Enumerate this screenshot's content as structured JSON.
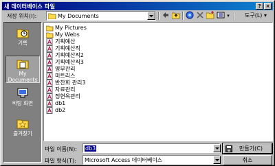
{
  "window": {
    "title": "새 데이터베이스 파일",
    "help_label": "?",
    "close_label": "×"
  },
  "lookin": {
    "label": "저장 위치(I):",
    "value": "My Documents"
  },
  "toolbar": {
    "back_icon": "back-arrow-icon",
    "up_icon": "up-folder-icon",
    "search_web_icon": "search-web-icon",
    "delete_icon": "delete-icon",
    "new_folder_icon": "new-folder-icon",
    "views_icon": "views-icon",
    "tools_label": "도구(L) ▾"
  },
  "places": [
    {
      "label": "기록",
      "icon": "history-icon"
    },
    {
      "label": "My Documents",
      "icon": "my-documents-icon",
      "selected": true
    },
    {
      "label": "바탕 화면",
      "icon": "desktop-icon"
    },
    {
      "label": "즐겨찾기",
      "icon": "favorites-icon"
    }
  ],
  "files": [
    {
      "name": "My Pictures",
      "type": "folder"
    },
    {
      "name": "My Webs",
      "type": "folder"
    },
    {
      "name": "기획예산",
      "type": "db"
    },
    {
      "name": "기획예산직",
      "type": "db"
    },
    {
      "name": "기획예산직2",
      "type": "db"
    },
    {
      "name": "기획예산직3",
      "type": "db"
    },
    {
      "name": "명부관리",
      "type": "db"
    },
    {
      "name": "미트리스",
      "type": "db"
    },
    {
      "name": "반찬회 관리3",
      "type": "db"
    },
    {
      "name": "자료관리",
      "type": "db"
    },
    {
      "name": "정현옥관리",
      "type": "db"
    },
    {
      "name": "db1",
      "type": "db"
    },
    {
      "name": "db2",
      "type": "db"
    }
  ],
  "filename": {
    "label": "파일 이름(N):",
    "value": "db3"
  },
  "filetype": {
    "label": "파일 형식(T):",
    "value": "Microsoft Access 데이터베이스"
  },
  "buttons": {
    "create_label": "만들기(C)",
    "cancel_label": "취소"
  },
  "colors": {
    "titlebar": "#000080",
    "face": "#c0c0c0",
    "places_bg": "#808080"
  }
}
